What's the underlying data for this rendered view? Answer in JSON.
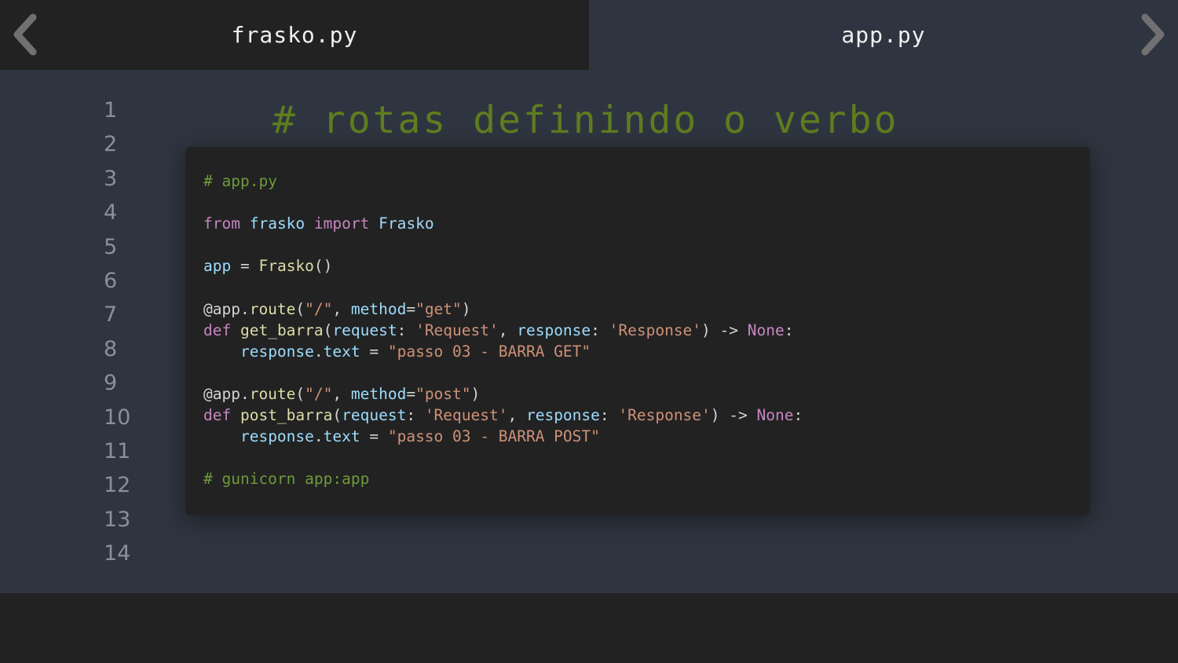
{
  "tabs": [
    {
      "label": "frasko.py",
      "active": true
    },
    {
      "label": "app.py",
      "active": false
    }
  ],
  "nav": {
    "prev_icon": "chevron-left-icon",
    "next_icon": "chevron-right-icon"
  },
  "line_numbers": [
    "1",
    "2",
    "3",
    "4",
    "5",
    "6",
    "7",
    "8",
    "9",
    "10",
    "11",
    "12",
    "13",
    "14"
  ],
  "heading": "# rotas definindo o verbo",
  "code": {
    "comment_file": "# app.py",
    "kw_from": "from",
    "module": "frasko",
    "kw_import": "import",
    "class_name": "Frasko",
    "app_var": "app",
    "assign_op": " = ",
    "call_parens": "()",
    "decorator_prefix": "@app.",
    "route_fn": "route",
    "route_path": "\"/\"",
    "method_kw": "method",
    "method_get": "\"get\"",
    "method_post": "\"post\"",
    "kw_def": "def",
    "fn_get": "get_barra",
    "fn_post": "post_barra",
    "param_request": "request",
    "type_request": "'Request'",
    "param_response": "response",
    "type_response": "'Response'",
    "arrow": " -> ",
    "kw_none": "None",
    "response_obj": "response",
    "text_attr": "text",
    "str_get": "\"passo 03 - BARRA GET\"",
    "str_post": "\"passo 03 - BARRA POST\"",
    "comment_run": "# gunicorn app:app"
  },
  "colors": {
    "editor_bg": "#2f3540",
    "panel_bg": "#222222",
    "heading_green": "#5e7d1f",
    "comment_green": "#6e9a3c",
    "keyword_purple": "#c586c0",
    "string_orange": "#ce9178",
    "variable_blue": "#9cdcfe",
    "function_yellow": "#dcdcaa"
  }
}
